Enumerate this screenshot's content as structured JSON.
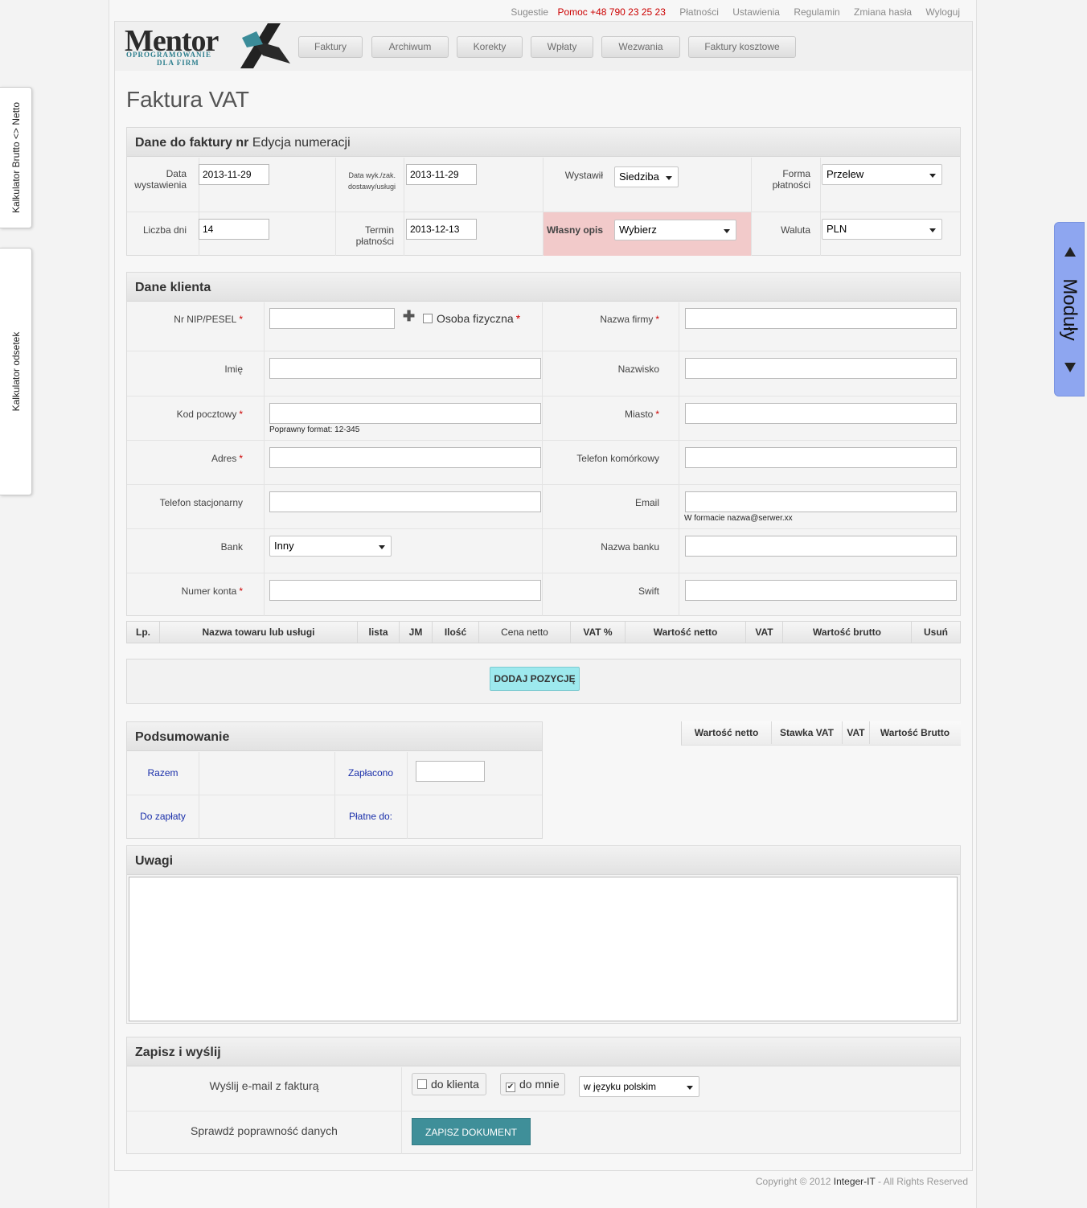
{
  "top_links": {
    "suggestions": "Sugestie",
    "help": "Pomoc +48 790 23 25 23",
    "payments": "Płatności",
    "settings": "Ustawienia",
    "terms": "Regulamin",
    "change_password": "Zmiana hasła",
    "logout": "Wyloguj"
  },
  "logo": {
    "word": "Mentor",
    "line1": "OPROGRAMOWANIE",
    "line2": "DLA FIRM"
  },
  "nav": [
    "Faktury",
    "Archiwum",
    "Korekty",
    "Wpłaty",
    "Wezwania",
    "Faktury kosztowe"
  ],
  "page_title": "Faktura VAT",
  "invoice_data": {
    "header_bold": "Dane do faktury nr",
    "header_link": "Edycja numeracji",
    "issue_date_label": "Data wystawienia",
    "issue_date": "2013-11-29",
    "delivery_date_label": "Data wyk./zak. dostawy/usługi",
    "delivery_date": "2013-11-29",
    "issued_by_label": "Wystawił",
    "issued_by": "Siedziba",
    "payment_form_label": "Forma płatności",
    "payment_form": "Przelew",
    "days_label": "Liczba dni",
    "days": "14",
    "due_date_label": "Termin płatności",
    "due_date": "2013-12-13",
    "own_desc_label": "Własny opis",
    "own_desc": "Wybierz",
    "currency_label": "Waluta",
    "currency": "PLN",
    "highlight_color": "#f2caca"
  },
  "client": {
    "header": "Dane klienta",
    "nip_label": "Nr NIP/PESEL",
    "person_label": "Osoba fizyczna",
    "company_label": "Nazwa firmy",
    "first_name_label": "Imię",
    "last_name_label": "Nazwisko",
    "postal_label": "Kod pocztowy",
    "postal_hint": "Poprawny format: 12-345",
    "city_label": "Miasto",
    "address_label": "Adres",
    "mobile_label": "Telefon komórkowy",
    "landline_label": "Telefon stacjonarny",
    "email_label": "Email",
    "email_hint": "W formacie nazwa@serwer.xx",
    "bank_label": "Bank",
    "bank": "Inny",
    "bank_name_label": "Nazwa banku",
    "account_label": "Numer konta",
    "swift_label": "Swift",
    "required_mark": "*"
  },
  "items_table": {
    "columns": [
      "Lp.",
      "Nazwa towaru lub usługi",
      "lista",
      "JM",
      "Ilość",
      "Cena netto",
      "VAT %",
      "Wartość netto",
      "VAT",
      "Wartość brutto",
      "Usuń"
    ],
    "add_button": "DODAJ POZYCJĘ",
    "add_button_color": "#9de9ee"
  },
  "summary": {
    "header": "Podsumowanie",
    "total_label": "Razem",
    "paid_label": "Zapłacono",
    "to_pay_label": "Do zapłaty",
    "due_label": "Płatne do:",
    "vat_columns": [
      "Wartość netto",
      "Stawka VAT",
      "VAT",
      "Wartość Brutto"
    ]
  },
  "notes": {
    "header": "Uwagi"
  },
  "save_send": {
    "header": "Zapisz i wyślij",
    "email_label": "Wyślij e-mail z fakturą",
    "to_client": "do klienta",
    "to_client_checked": false,
    "to_me": "do mnie",
    "to_me_checked": true,
    "language": "w języku polskim",
    "check_label": "Sprawdź poprawność danych",
    "save_button": "ZAPISZ DOKUMENT",
    "save_button_color": "#3f8f99"
  },
  "footer": {
    "prefix": "Copyright © 2012",
    "brand": "Integer-IT",
    "suffix": "- All Rights Reserved"
  },
  "side_tabs": {
    "gross_net": "Kalkulator Brutto <> Netto",
    "interest": "Kalkulator odsetek",
    "modules": "Moduły"
  }
}
